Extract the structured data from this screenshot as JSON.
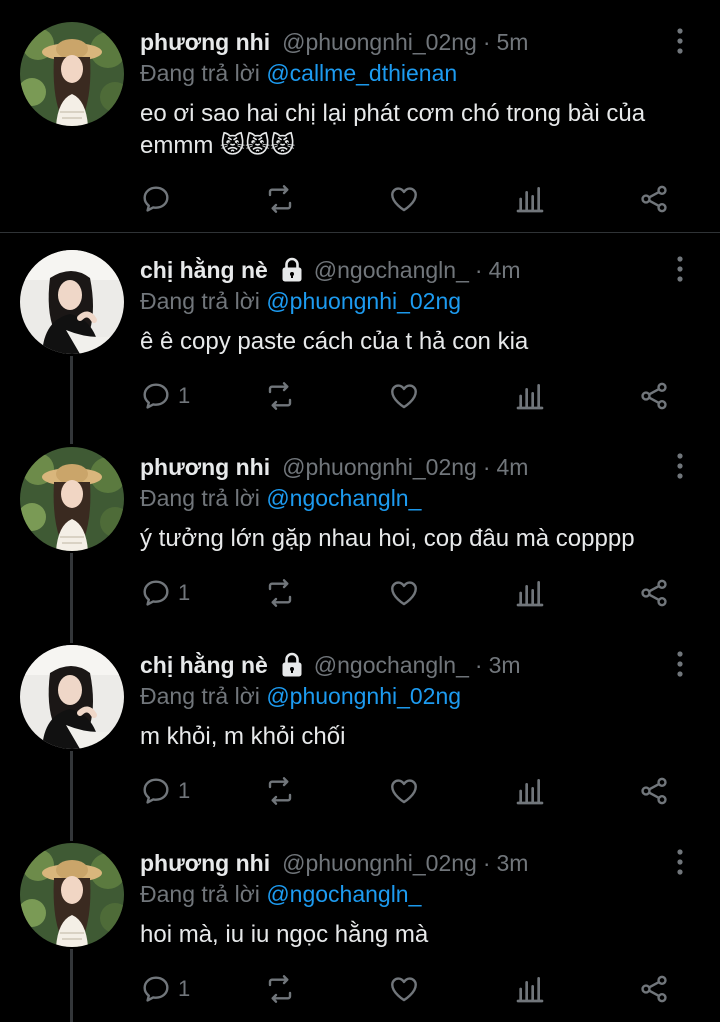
{
  "tweets": [
    {
      "name": "phương nhi",
      "locked": false,
      "handle": "@phuongnhi_02ng",
      "time": "5m",
      "reply_prefix": "Đang trả lời",
      "reply_to": "@callme_dthienan",
      "text_line1": "eo ơi sao hai chị lại phát cơm chó trong bài của",
      "text_line2": "emmm 😾😾😾",
      "reply_count": ""
    },
    {
      "name": "chị hằng nè",
      "locked": true,
      "handle": "@ngochangln_",
      "time": "4m",
      "reply_prefix": "Đang trả lời",
      "reply_to": "@phuongnhi_02ng",
      "text_line1": "ê ê copy paste cách của t hả con kia",
      "text_line2": "",
      "reply_count": "1"
    },
    {
      "name": "phương nhi",
      "locked": false,
      "handle": "@phuongnhi_02ng",
      "time": "4m",
      "reply_prefix": "Đang trả lời",
      "reply_to": "@ngochangln_",
      "text_line1": "ý tưởng lớn gặp nhau hoi, cop đâu mà copppp",
      "text_line2": "",
      "reply_count": "1"
    },
    {
      "name": "chị hằng nè",
      "locked": true,
      "handle": "@ngochangln_",
      "time": "3m",
      "reply_prefix": "Đang trả lời",
      "reply_to": "@phuongnhi_02ng",
      "text_line1": "m khỏi, m khỏi chối",
      "text_line2": "",
      "reply_count": "1"
    },
    {
      "name": "phương nhi",
      "locked": false,
      "handle": "@phuongnhi_02ng",
      "time": "3m",
      "reply_prefix": "Đang trả lời",
      "reply_to": "@ngochangln_",
      "text_line1": "hoi mà, iu iu ngọc hằng mà",
      "text_line2": "",
      "reply_count": "1"
    }
  ],
  "icons": {
    "reply": "reply-bubble-icon",
    "retweet": "retweet-icon",
    "like": "heart-icon",
    "stats": "bar-chart-icon",
    "share": "share-icon",
    "more": "more-vertical-icon",
    "lock": "lock-icon"
  },
  "colors": {
    "background": "#000000",
    "text": "#e7e9ea",
    "muted": "#71767b",
    "mention": "#1d9bf0"
  }
}
